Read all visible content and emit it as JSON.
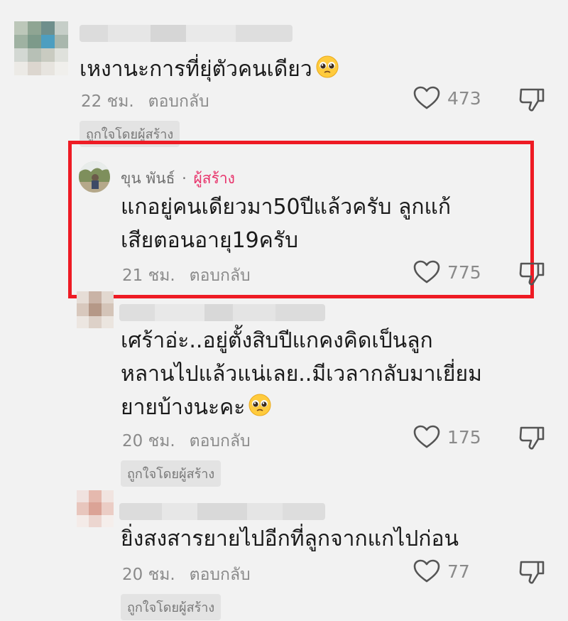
{
  "comments": [
    {
      "text_lines": [
        "เหงานะการที่ยุ่ตัวคนเดียว"
      ],
      "has_emoji": true,
      "emoji": "pleading-face",
      "time": "22 ชม.",
      "reply": "ตอบกลับ",
      "likes": "473",
      "badge": "ถูกใจโดยผู้สร้าง"
    },
    {
      "author": "ขุน พันธ์",
      "separator": "·",
      "author_role": "ผู้สร้าง",
      "text_lines": [
        "แกอยู่คนเดียวมา50ปีแล้วครับ ลูกแก้",
        "เสียตอนอายุ19ครับ"
      ],
      "time": "21 ชม.",
      "reply": "ตอบกลับ",
      "likes": "775"
    },
    {
      "text_lines": [
        "เศร้าอ่ะ..อยู่ตั้งสิบปีแกคงคิดเป็นลูก",
        "หลานไปแล้วแน่เลย..มีเวลากลับมาเยี่ยม",
        "ยายบ้างนะคะ"
      ],
      "has_emoji": true,
      "emoji": "pleading-face",
      "time": "20 ชม.",
      "reply": "ตอบกลับ",
      "likes": "175",
      "badge": "ถูกใจโดยผู้สร้าง"
    },
    {
      "text_lines": [
        "ยิ่งสงสารยายไปอีกที่ลูกจากแกไปก่อน"
      ],
      "time": "20 ชม.",
      "reply": "ตอบกลับ",
      "likes": "77",
      "badge": "ถูกใจโดยผู้สร้าง"
    }
  ],
  "colors": {
    "background": "#f2f2f2",
    "highlight_border": "#ee1b24",
    "creator_label": "#e8336b",
    "meta_text": "#8a8a8a"
  }
}
